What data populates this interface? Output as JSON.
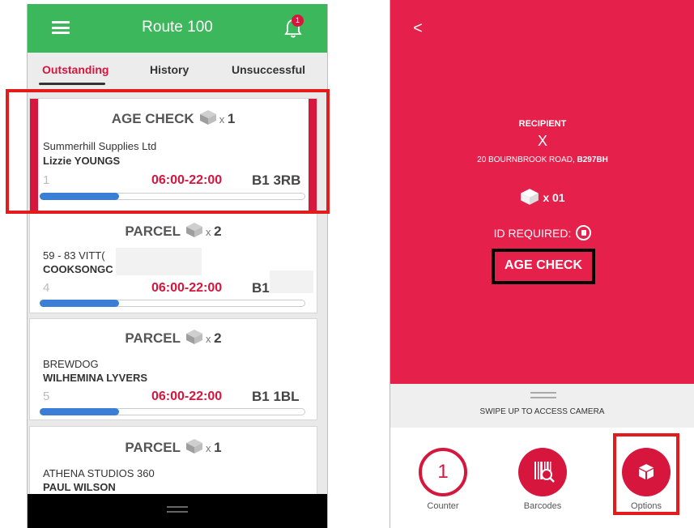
{
  "left_screen": {
    "header": {
      "title": "Route 100",
      "notification_count": "1"
    },
    "tabs": [
      {
        "label": "Outstanding",
        "active": true
      },
      {
        "label": "History",
        "active": false
      },
      {
        "label": "Unsuccessful",
        "active": false
      }
    ],
    "cards": [
      {
        "type": "AGE CHECK",
        "qty_prefix": "x",
        "qty": "1",
        "company": "Summerhill Supplies Ltd",
        "person": "Lizzie YOUNGS",
        "number": "1",
        "time": "06:00-22:00",
        "postcode": "B1 3RB",
        "progress": 0.3
      },
      {
        "type": "PARCEL",
        "qty_prefix": "x",
        "qty": "2",
        "company": "59 - 83 VITT(",
        "person": "COOKSONGC",
        "number": "4",
        "time": "06:00-22:00",
        "postcode": "B1",
        "progress": 0.3
      },
      {
        "type": "PARCEL",
        "qty_prefix": "x",
        "qty": "2",
        "company": "BREWDOG",
        "person": "WILHEMINA LYVERS",
        "number": "5",
        "time": "06:00-22:00",
        "postcode": "B1 1BL",
        "progress": 0.3
      },
      {
        "type": "PARCEL",
        "qty_prefix": "x",
        "qty": "1",
        "company": "ATHENA STUDIOS 360",
        "person": "PAUL WILSON"
      }
    ]
  },
  "right_screen": {
    "back_label": "<",
    "recipient_heading": "RECIPIENT",
    "recipient_name": "X",
    "address_plain": "20 BOURNBROOK ROAD, ",
    "address_bold": "B297BH",
    "parcel_count": "x 01",
    "id_required": "ID REQUIRED:",
    "age_check": "AGE CHECK",
    "swipe_text": "SWIPE UP TO ACCESS CAMERA",
    "actions": [
      {
        "label": "Counter",
        "value": "1"
      },
      {
        "label": "Barcodes"
      },
      {
        "label": "Options"
      }
    ]
  },
  "colors": {
    "green": "#3cb75c",
    "red": "#d6163d",
    "panel_red": "#e5204a",
    "progress_blue": "#3b7ed6",
    "highlight": "#e31b1b"
  }
}
